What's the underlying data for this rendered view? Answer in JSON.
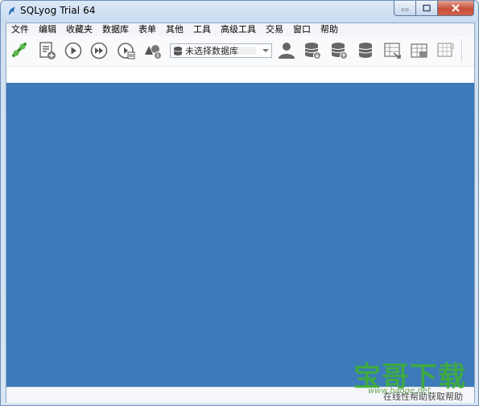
{
  "window": {
    "title": "SQLyog Trial 64"
  },
  "menu": [
    "文件",
    "编辑",
    "收藏夹",
    "数据库",
    "表单",
    "其他",
    "工具",
    "高级工具",
    "交易",
    "窗口",
    "帮助"
  ],
  "toolbar": {
    "database_select": {
      "selected": "未选择数据库"
    },
    "icons": [
      "connect-icon",
      "new-query-icon",
      "execute-icon",
      "execute-all-icon",
      "execute-edit-icon",
      "schema-icon",
      "user-manager-icon",
      "backup-db-icon",
      "restore-db-icon",
      "copy-db-icon",
      "export-table-icon",
      "import-table-icon",
      "table-grid-icon"
    ]
  },
  "status": {
    "text": "在线性帮助获取帮助"
  },
  "watermark": {
    "text": "宝哥下载",
    "url": "www.baoge.net"
  },
  "colors": {
    "workspace": "#3c7ab9",
    "accent_green": "#3fae3a"
  }
}
